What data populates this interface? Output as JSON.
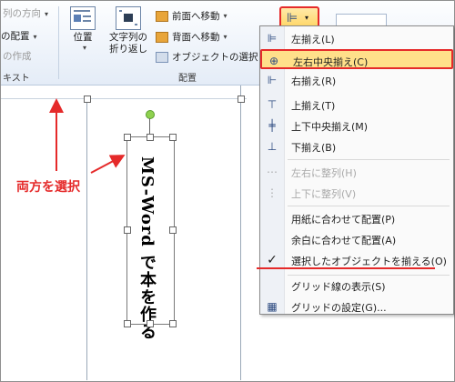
{
  "ribbon": {
    "text_group": {
      "direction_label": "列の方向",
      "position_label": "の配置",
      "create_label": "の作成",
      "group_label": "キスト"
    },
    "arrange_group": {
      "position_button": "位置",
      "wrap_button_line1": "文字列の",
      "wrap_button_line2": "折り返し",
      "bring_forward": "前面へ移動",
      "send_backward": "背面へ移動",
      "selection_pane": "オブジェクトの選択と",
      "group_label": "配置"
    },
    "size_combo_value": ""
  },
  "document": {
    "vertical_text": "MS-Word で本を作る",
    "annotation": "両方を選択"
  },
  "menu": {
    "items": [
      {
        "label": "左揃え(L)",
        "icon": "align-left-icon",
        "enabled": true
      },
      {
        "label": "左右中央揃え(C)",
        "icon": "align-center-icon",
        "enabled": true,
        "highlighted": true
      },
      {
        "label": "右揃え(R)",
        "icon": "align-right-icon",
        "enabled": true
      },
      {
        "label": "上揃え(T)",
        "icon": "align-top-icon",
        "enabled": true
      },
      {
        "label": "上下中央揃え(M)",
        "icon": "align-middle-icon",
        "enabled": true
      },
      {
        "label": "下揃え(B)",
        "icon": "align-bottom-icon",
        "enabled": true
      },
      {
        "label": "左右に整列(H)",
        "icon": "distribute-horizontal-icon",
        "enabled": false
      },
      {
        "label": "上下に整列(V)",
        "icon": "distribute-vertical-icon",
        "enabled": false
      },
      {
        "label": "用紙に合わせて配置(P)",
        "icon": "",
        "enabled": true
      },
      {
        "label": "余白に合わせて配置(A)",
        "icon": "",
        "enabled": true
      },
      {
        "label": "選択したオブジェクトを揃える(O)",
        "icon": "checkmark-icon",
        "enabled": true,
        "checked": true
      },
      {
        "label": "グリッド線の表示(S)",
        "icon": "",
        "enabled": true
      },
      {
        "label": "グリッドの設定(G)...",
        "icon": "grid-icon",
        "enabled": true
      }
    ]
  },
  "colors": {
    "accent_red": "#e52a2a",
    "highlight": "#ffe08a"
  }
}
